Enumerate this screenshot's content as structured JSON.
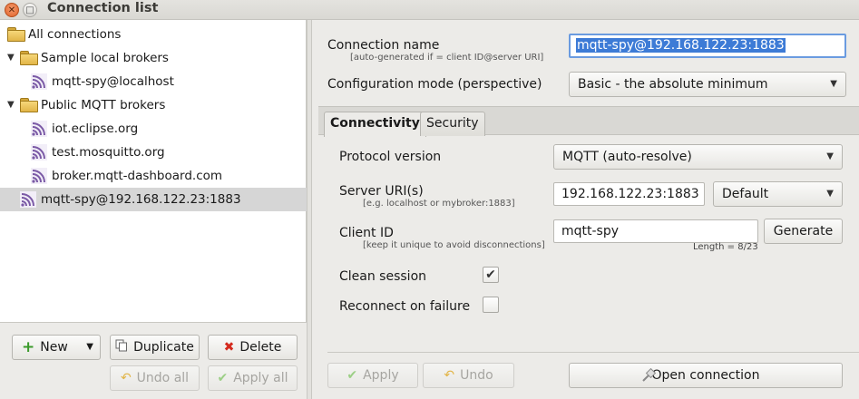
{
  "window": {
    "title": "Connection list"
  },
  "tree": {
    "items": [
      {
        "label": "All connections",
        "kind": "folder",
        "level": 0,
        "expanded": null,
        "selected": false
      },
      {
        "label": "Sample local brokers",
        "kind": "folder",
        "level": 1,
        "expanded": true,
        "selected": false
      },
      {
        "label": "mqtt-spy@localhost",
        "kind": "connection",
        "level": 2,
        "expanded": null,
        "selected": false
      },
      {
        "label": "Public MQTT brokers",
        "kind": "folder",
        "level": 1,
        "expanded": true,
        "selected": false
      },
      {
        "label": "iot.eclipse.org",
        "kind": "connection",
        "level": 2,
        "expanded": null,
        "selected": false
      },
      {
        "label": "test.mosquitto.org",
        "kind": "connection",
        "level": 2,
        "expanded": null,
        "selected": false
      },
      {
        "label": "broker.mqtt-dashboard.com",
        "kind": "connection",
        "level": 2,
        "expanded": null,
        "selected": false
      },
      {
        "label": "mqtt-spy@192.168.122.23:1883",
        "kind": "connection",
        "level": 1,
        "expanded": null,
        "selected": true
      }
    ]
  },
  "left_buttons": {
    "new": "New",
    "duplicate": "Duplicate",
    "delete": "Delete",
    "undo_all": "Undo all",
    "apply_all": "Apply all"
  },
  "form": {
    "connection_name_label": "Connection name",
    "connection_name_hint": "[auto-generated if = client ID@server URI]",
    "connection_name_value": "mqtt-spy@192.168.122.23:1883",
    "config_mode_label": "Configuration mode (perspective)",
    "config_mode_value": "Basic - the absolute minimum"
  },
  "tabs": [
    "Connectivity",
    "Security"
  ],
  "connectivity": {
    "protocol_label": "Protocol version",
    "protocol_value": "MQTT (auto-resolve)",
    "server_uri_label": "Server URI(s)",
    "server_uri_hint": "[e.g. localhost or mybroker:1883]",
    "server_uri_value": "192.168.122.23:1883",
    "server_uri_mode": "Default",
    "client_id_label": "Client ID",
    "client_id_hint": "[keep it unique to avoid disconnections]",
    "client_id_value": "mqtt-spy",
    "client_id_length": "Length = 8/23",
    "generate_button": "Generate",
    "clean_session_label": "Clean session",
    "clean_session_checked": true,
    "reconnect_label": "Reconnect on failure",
    "reconnect_checked": false
  },
  "bottom_buttons": {
    "apply": "Apply",
    "undo": "Undo",
    "open_connection": "Open connection"
  },
  "colors": {
    "selection": "#3d7bd6",
    "focus_border": "#6a9be0",
    "tree_selected": "#d6d6d6",
    "folder": "#e2b548",
    "mqtt_icon": "#7b5aa6"
  }
}
